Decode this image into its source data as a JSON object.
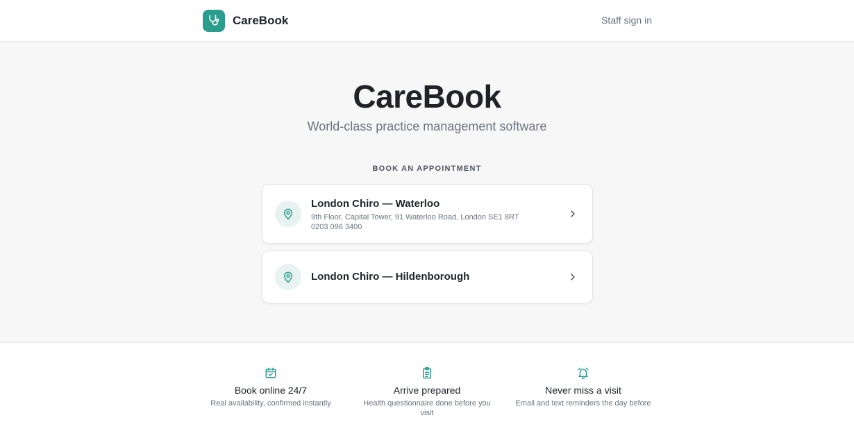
{
  "header": {
    "brand_name": "CareBook",
    "staff_sign_in": "Staff sign in"
  },
  "hero": {
    "title": "CareBook",
    "subtitle": "World-class practice management software"
  },
  "booking": {
    "section_label": "BOOK AN APPOINTMENT",
    "locations": [
      {
        "name": "London Chiro — Waterloo",
        "address": "9th Floor, Capital Tower, 91 Waterloo Road, London SE1 8RT",
        "phone": "0203 096 3400"
      },
      {
        "name": "London Chiro — Hildenborough"
      }
    ]
  },
  "features": [
    {
      "icon": "calendar-check-icon",
      "title": "Book online 24/7",
      "description": "Real availability, confirmed instantly"
    },
    {
      "icon": "clipboard-list-icon",
      "title": "Arrive prepared",
      "description": "Health questionnaire done before you visit"
    },
    {
      "icon": "alarm-bell-icon",
      "title": "Never miss a visit",
      "description": "Email and text reminders the day before"
    }
  ],
  "colors": {
    "accent": "#2a9d8f",
    "icon_bg": "#e8f3f1",
    "page_bg": "#f7f7f7",
    "text_primary": "#1f2328",
    "text_muted": "#6b7280"
  }
}
